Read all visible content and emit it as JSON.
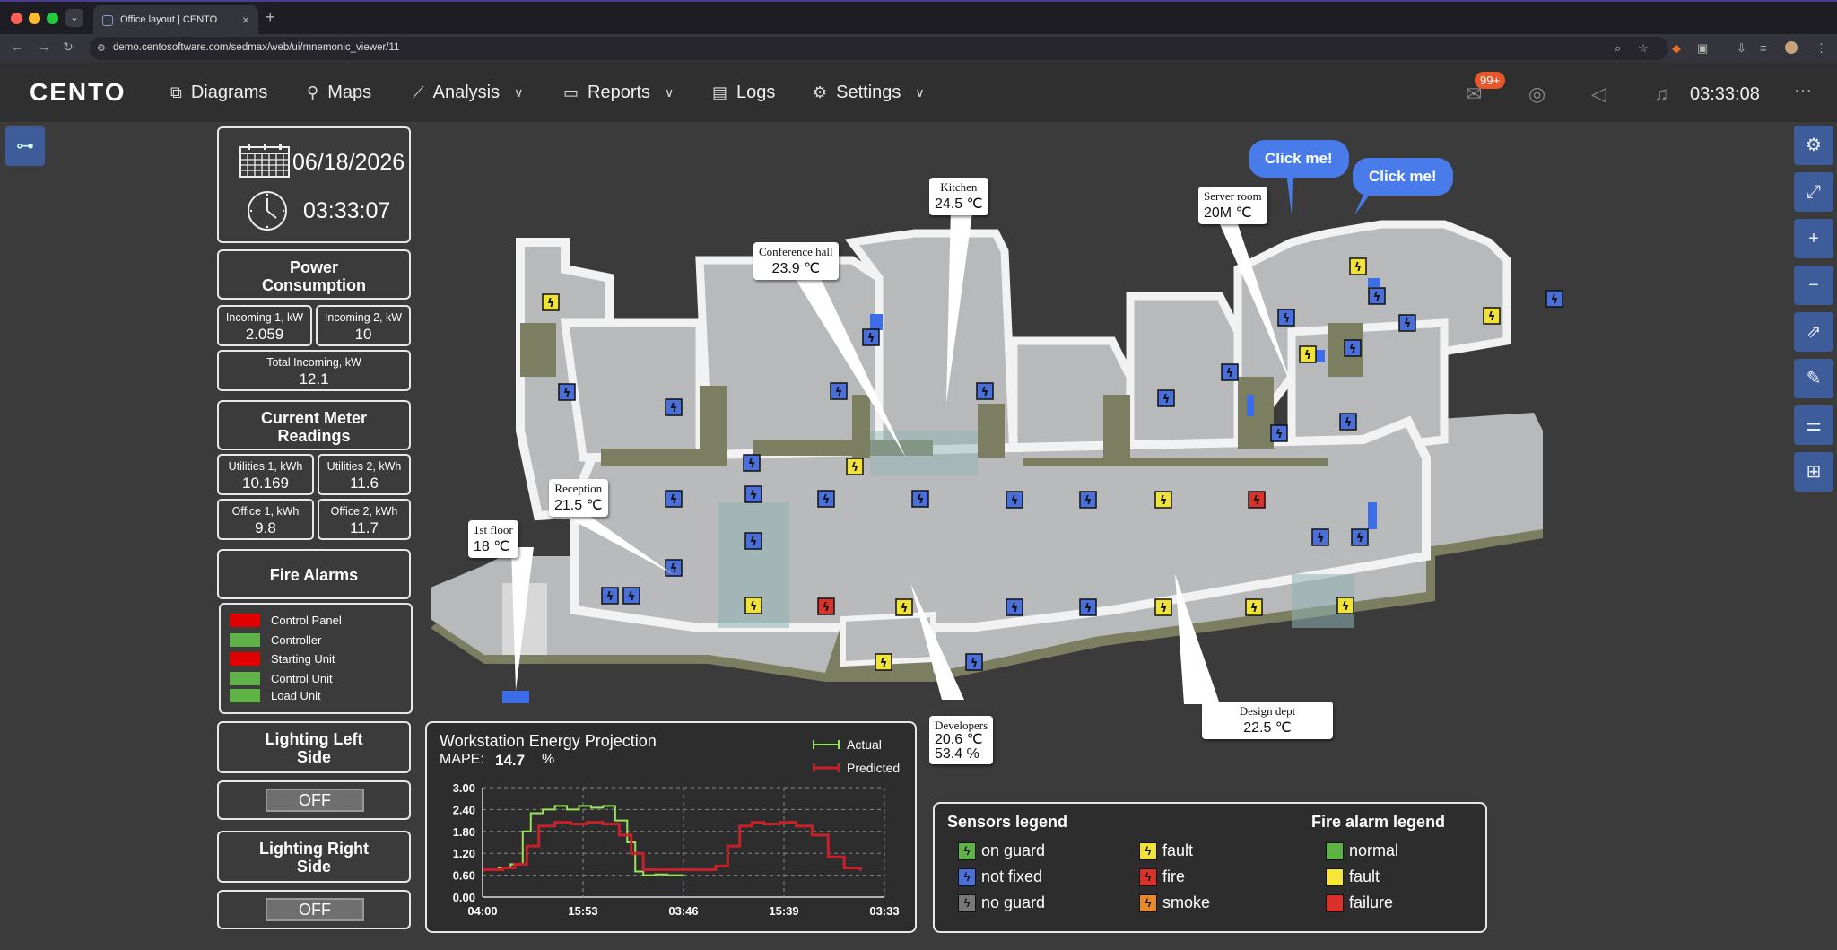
{
  "browser": {
    "tab_title": "Office layout | CENTO",
    "url": "demo.centosoftware.com/sedmax/web/ui/mnemonic_viewer/11"
  },
  "header": {
    "logo": "CENTO",
    "menu": [
      {
        "label": "Diagrams",
        "icon": "diagram-icon"
      },
      {
        "label": "Maps",
        "icon": "pin-icon"
      },
      {
        "label": "Analysis",
        "icon": "chart-icon"
      },
      {
        "label": "Reports",
        "icon": "folder-icon"
      },
      {
        "label": "Logs",
        "icon": "book-icon"
      },
      {
        "label": "Settings",
        "icon": "gear-icon"
      }
    ],
    "mail_badge": "99+",
    "time": "03:33:08"
  },
  "datetime": {
    "date": "06/18/2026",
    "time": "03:33:07"
  },
  "power": {
    "title": "Power Consumption",
    "incoming1_label": "Incoming 1, kW",
    "incoming1_value": "2.059",
    "incoming2_label": "Incoming 2, kW",
    "incoming2_value": "10",
    "total_label": "Total Incoming, kW",
    "total_value": "12.1"
  },
  "meters": {
    "title": "Current Meter Readings",
    "u1_label": "Utilities 1, kWh",
    "u1_value": "10.169",
    "u2_label": "Utilities 2, kWh",
    "u2_value": "11.6",
    "o1_label": "Office 1, kWh",
    "o1_value": "9.8",
    "o2_label": "Office 2, kWh",
    "o2_value": "11.7"
  },
  "fire": {
    "title": "Fire Alarms",
    "items": [
      {
        "label": "Control Panel",
        "color": "#e00000"
      },
      {
        "label": "Controller",
        "color": "#5fb346"
      },
      {
        "label": "Starting Unit",
        "color": "#e00000"
      },
      {
        "label": "Control Unit",
        "color": "#5fb346"
      },
      {
        "label": "Load Unit",
        "color": "#5fb346"
      }
    ]
  },
  "lighting": {
    "left_title": "Lighting Left Side",
    "left_state": "OFF",
    "right_title": "Lighting Right Side",
    "right_state": "OFF"
  },
  "rooms": {
    "kitchen": {
      "name": "Kitchen",
      "value": "24.5 ℃"
    },
    "conference": {
      "name": "Conference hall",
      "value": "23.9 ℃"
    },
    "server": {
      "name": "Server room",
      "value": "20M ℃"
    },
    "reception": {
      "name": "Reception",
      "value": "21.5 ℃"
    },
    "first_floor": {
      "name": "1st floor",
      "value": "18 ℃"
    },
    "developers": {
      "name": "Developers",
      "value1": "20.6 ℃",
      "value2": "53.4 %"
    },
    "design": {
      "name": "Design dept",
      "value": "22.5 ℃"
    }
  },
  "bubbles": {
    "b1": "Click me!",
    "b2": "Click me!"
  },
  "chart": {
    "title": "Workstation Energy Projection",
    "mape_label": "MAPE:",
    "mape_value": "14.7",
    "mape_unit": "%",
    "legend_actual": "Actual",
    "legend_predicted": "Predicted"
  },
  "chart_data": {
    "type": "line",
    "title": "Workstation Energy Projection",
    "ylim": [
      0,
      3.0
    ],
    "yticks": [
      "0.00",
      "0.60",
      "1.20",
      "1.80",
      "2.40",
      "3.00"
    ],
    "xticks": [
      "04:00",
      "15:53",
      "03:46",
      "15:39",
      "03:33"
    ],
    "grid": true,
    "legend": "top-right",
    "series": [
      {
        "name": "Actual",
        "color": "#9be35a",
        "x": [
          0,
          0.04,
          0.07,
          0.1,
          0.12,
          0.15,
          0.18,
          0.21,
          0.24,
          0.27,
          0.3,
          0.33,
          0.36,
          0.38,
          0.4,
          0.43,
          0.46,
          0.5
        ],
        "values": [
          0.75,
          0.8,
          0.9,
          1.8,
          2.3,
          2.4,
          2.5,
          2.4,
          2.5,
          2.45,
          2.5,
          2.1,
          1.5,
          0.7,
          0.6,
          0.62,
          0.6,
          0.6
        ]
      },
      {
        "name": "Predicted",
        "color": "#c8202a",
        "x": [
          0,
          0.05,
          0.08,
          0.11,
          0.14,
          0.18,
          0.22,
          0.26,
          0.3,
          0.34,
          0.37,
          0.4,
          0.45,
          0.5,
          0.55,
          0.58,
          0.61,
          0.64,
          0.67,
          0.7,
          0.74,
          0.78,
          0.82,
          0.86,
          0.9,
          0.94
        ],
        "values": [
          0.75,
          0.8,
          0.9,
          1.4,
          1.95,
          2.05,
          2.0,
          2.05,
          2.0,
          1.7,
          1.2,
          0.75,
          0.75,
          0.75,
          0.75,
          0.85,
          1.4,
          1.95,
          2.05,
          2.0,
          2.05,
          1.95,
          1.7,
          1.1,
          0.8,
          0.72
        ]
      }
    ]
  },
  "legend": {
    "sensors_title": "Sensors legend",
    "fire_title": "Fire alarm legend",
    "on_guard": "on guard",
    "not_fixed": "not fixed",
    "no_guard": "no guard",
    "fault": "fault",
    "fire": "fire",
    "smoke": "smoke",
    "normal": "normal",
    "f_fault": "fault",
    "failure": "failure"
  }
}
